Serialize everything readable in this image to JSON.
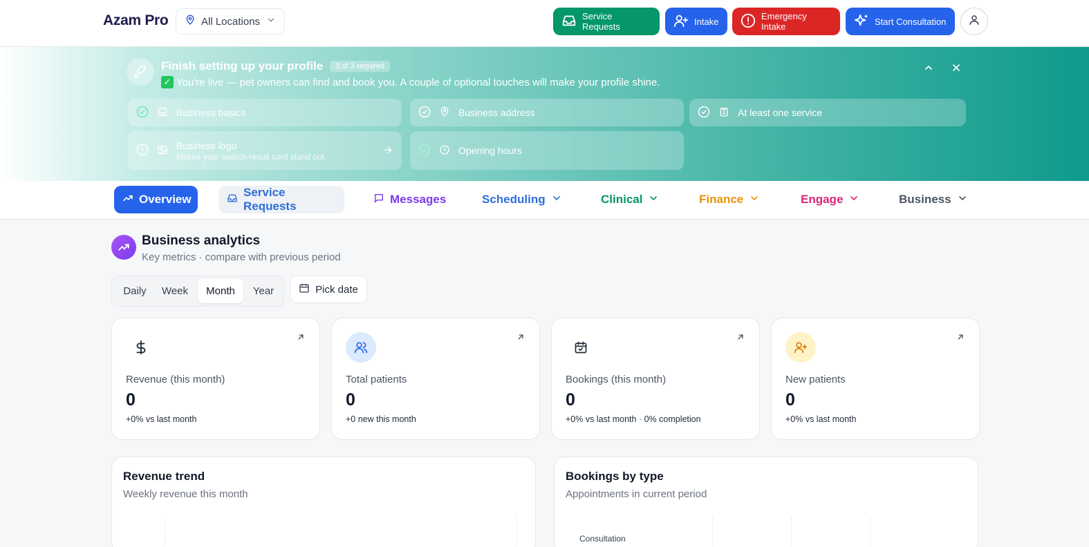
{
  "header": {
    "brand": "Azam Pro",
    "location_select": "All Locations",
    "buttons": {
      "service_requests": "Service Requests",
      "intake": "Intake",
      "emergency_intake": "Emergency Intake",
      "start_consultation": "Start Consultation"
    }
  },
  "banner": {
    "title": "Finish setting up your profile",
    "badge": "3 of 3 required",
    "subtitle": "You're live — pet owners can find and book you. A couple of optional touches will make your profile shine.",
    "steps": [
      {
        "label": "Business basics",
        "done": true,
        "icon": "store-icon"
      },
      {
        "label": "Business address",
        "done": true,
        "icon": "map-pin-icon"
      },
      {
        "label": "At least one service",
        "done": true,
        "icon": "clipboard-icon"
      },
      {
        "label": "Business logo",
        "hint": "Makes your search-result card stand out.",
        "done": false,
        "icon": "image-icon"
      },
      {
        "label": "Opening hours",
        "done": true,
        "icon": "clock-icon"
      }
    ]
  },
  "nav": {
    "tabs": [
      "Overview",
      "Service Requests",
      "Messages",
      "Scheduling",
      "Clinical",
      "Finance",
      "Engage",
      "Business"
    ],
    "active": "Overview"
  },
  "analytics": {
    "title": "Business analytics",
    "subtitle": "Key metrics · compare with previous period",
    "periods": [
      "Daily",
      "Week",
      "Month",
      "Year"
    ],
    "selected_period": "Month",
    "pick_date": "Pick date",
    "cards": [
      {
        "label": "Revenue (this month)",
        "value": "0",
        "note": "+0% vs last month",
        "icon": "dollar-icon"
      },
      {
        "label": "Total patients",
        "value": "0",
        "note": "+0 new this month",
        "icon": "users-icon"
      },
      {
        "label": "Bookings (this month)",
        "value": "0",
        "note": "+0% vs last month · 0% completion",
        "icon": "calendar-check-icon"
      },
      {
        "label": "New patients",
        "value": "0",
        "note": "+0% vs last month",
        "icon": "user-plus-icon"
      }
    ]
  },
  "panels": {
    "revenue": {
      "title": "Revenue trend",
      "subtitle": "Weekly revenue this month"
    },
    "bookings": {
      "title": "Bookings by type",
      "subtitle": "Appointments in current period",
      "first_category": "Consultation"
    }
  },
  "colors": {
    "primary": "#2563eb",
    "success": "#059669",
    "danger": "#dc2626",
    "brand": "#1e1b4b"
  }
}
